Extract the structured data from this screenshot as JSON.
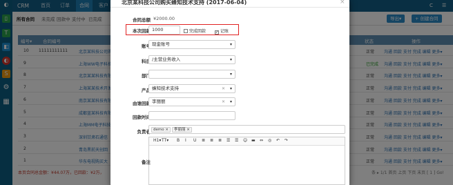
{
  "app": {
    "brand": "CRM"
  },
  "nav": {
    "items": [
      "首页",
      "订单",
      "合同",
      "客户"
    ],
    "active_index": 2,
    "right_c": "C",
    "right_menu": "☰"
  },
  "rail": {
    "icons": [
      {
        "name": "app-logo-icon",
        "glyph": "◐",
        "color": "#0c7cc0"
      },
      {
        "name": "green-doc-icon",
        "glyph": "▯",
        "color": "#2ba24c"
      },
      {
        "name": "teal-t-icon",
        "glyph": "T",
        "color": "#2ba24c"
      },
      {
        "name": "blue-d-icon",
        "glyph": "◧",
        "color": "#1c8fd0"
      },
      {
        "name": "red-d-icon",
        "glyph": "◐",
        "color": "#d9352b"
      },
      {
        "name": "orange-s-icon",
        "glyph": "S",
        "color": "#f39c12"
      },
      {
        "name": "gear-icon",
        "glyph": "⚙",
        "color": "transparent"
      },
      {
        "name": "grid-icon",
        "glyph": "▦",
        "color": "transparent"
      }
    ]
  },
  "subtabs": [
    "所有合同",
    "未完成",
    "回款中",
    "支付中",
    "已完成"
  ],
  "toolbar": {
    "export_label": "导出▾",
    "create_label": "+ 创建合同"
  },
  "table": {
    "headers": [
      "编号▾",
      "合同编号",
      "状态",
      "操作"
    ],
    "rows": [
      {
        "no": "10",
        "code": "11111111111",
        "name": "北京某科技公司购",
        "status": "正常",
        "done": false
      },
      {
        "no": "9",
        "code": "",
        "name": "上海WW电子科技有",
        "status": "已完成",
        "done": true
      },
      {
        "no": "8",
        "code": "",
        "name": "北京某某科技有限",
        "status": "正常",
        "done": false
      },
      {
        "no": "7",
        "code": "",
        "name": "上海某某技术开发有",
        "status": "正常",
        "done": false
      },
      {
        "no": "6",
        "code": "",
        "name": "南京某某科技有限公",
        "status": "正常",
        "done": false
      },
      {
        "no": "5",
        "code": "",
        "name": "成都蓝某科技有限",
        "status": "正常",
        "done": false
      },
      {
        "no": "4",
        "code": "",
        "name": "上海MM电子科技",
        "status": "正常",
        "done": false
      },
      {
        "no": "3",
        "code": "",
        "name": "深圳甘肃石通信",
        "status": "正常",
        "done": false
      },
      {
        "no": "2",
        "code": "",
        "name": "青岛黑前天创回",
        "status": "正常",
        "done": false
      },
      {
        "no": "1",
        "code": "",
        "name": "华东电视购买大",
        "status": "正常",
        "done": false
      }
    ],
    "ops_label": "沟通 回款 支付 完成 编辑 更多▾",
    "footer_left": "本页合同总金额：¥44.07万，已回款：¥2万，",
    "footer_right": "条 ▸ 1/1 首页 上页 下页 末页 [ 1 ] Go!"
  },
  "modal": {
    "title": "北京某科技公司购买蜂知技术支持 (2017-06-04)",
    "contract_amount_label": "合同总额",
    "contract_amount_value": "¥2000.00",
    "this_payment_label": "本次回款",
    "this_payment_value": "1000",
    "complete_payment_label": "完成回款",
    "record_label": "记账",
    "account_label": "账号",
    "account_value": "现金账号",
    "subject_label": "科目",
    "subject_value": "/主营业务收入",
    "department_label": "部门",
    "department_value": "",
    "product_label": "产品",
    "product_value": "蜂知技术支持",
    "receiver_label": "由谁回款",
    "receiver_value": "李丽丽",
    "payment_time_label": "回款时间",
    "payment_time_value": "",
    "handler_label": "负责者",
    "handler_tags": [
      "demo",
      "李丽丽"
    ],
    "remark_label": "备注",
    "editor_toolbar": [
      "H1▾",
      "TT▾",
      "B",
      "I",
      "U",
      "≣",
      "≣",
      "≣",
      "☰",
      "☰",
      "☺",
      "▬",
      "⇔",
      "◎",
      "↶",
      "↷"
    ]
  }
}
